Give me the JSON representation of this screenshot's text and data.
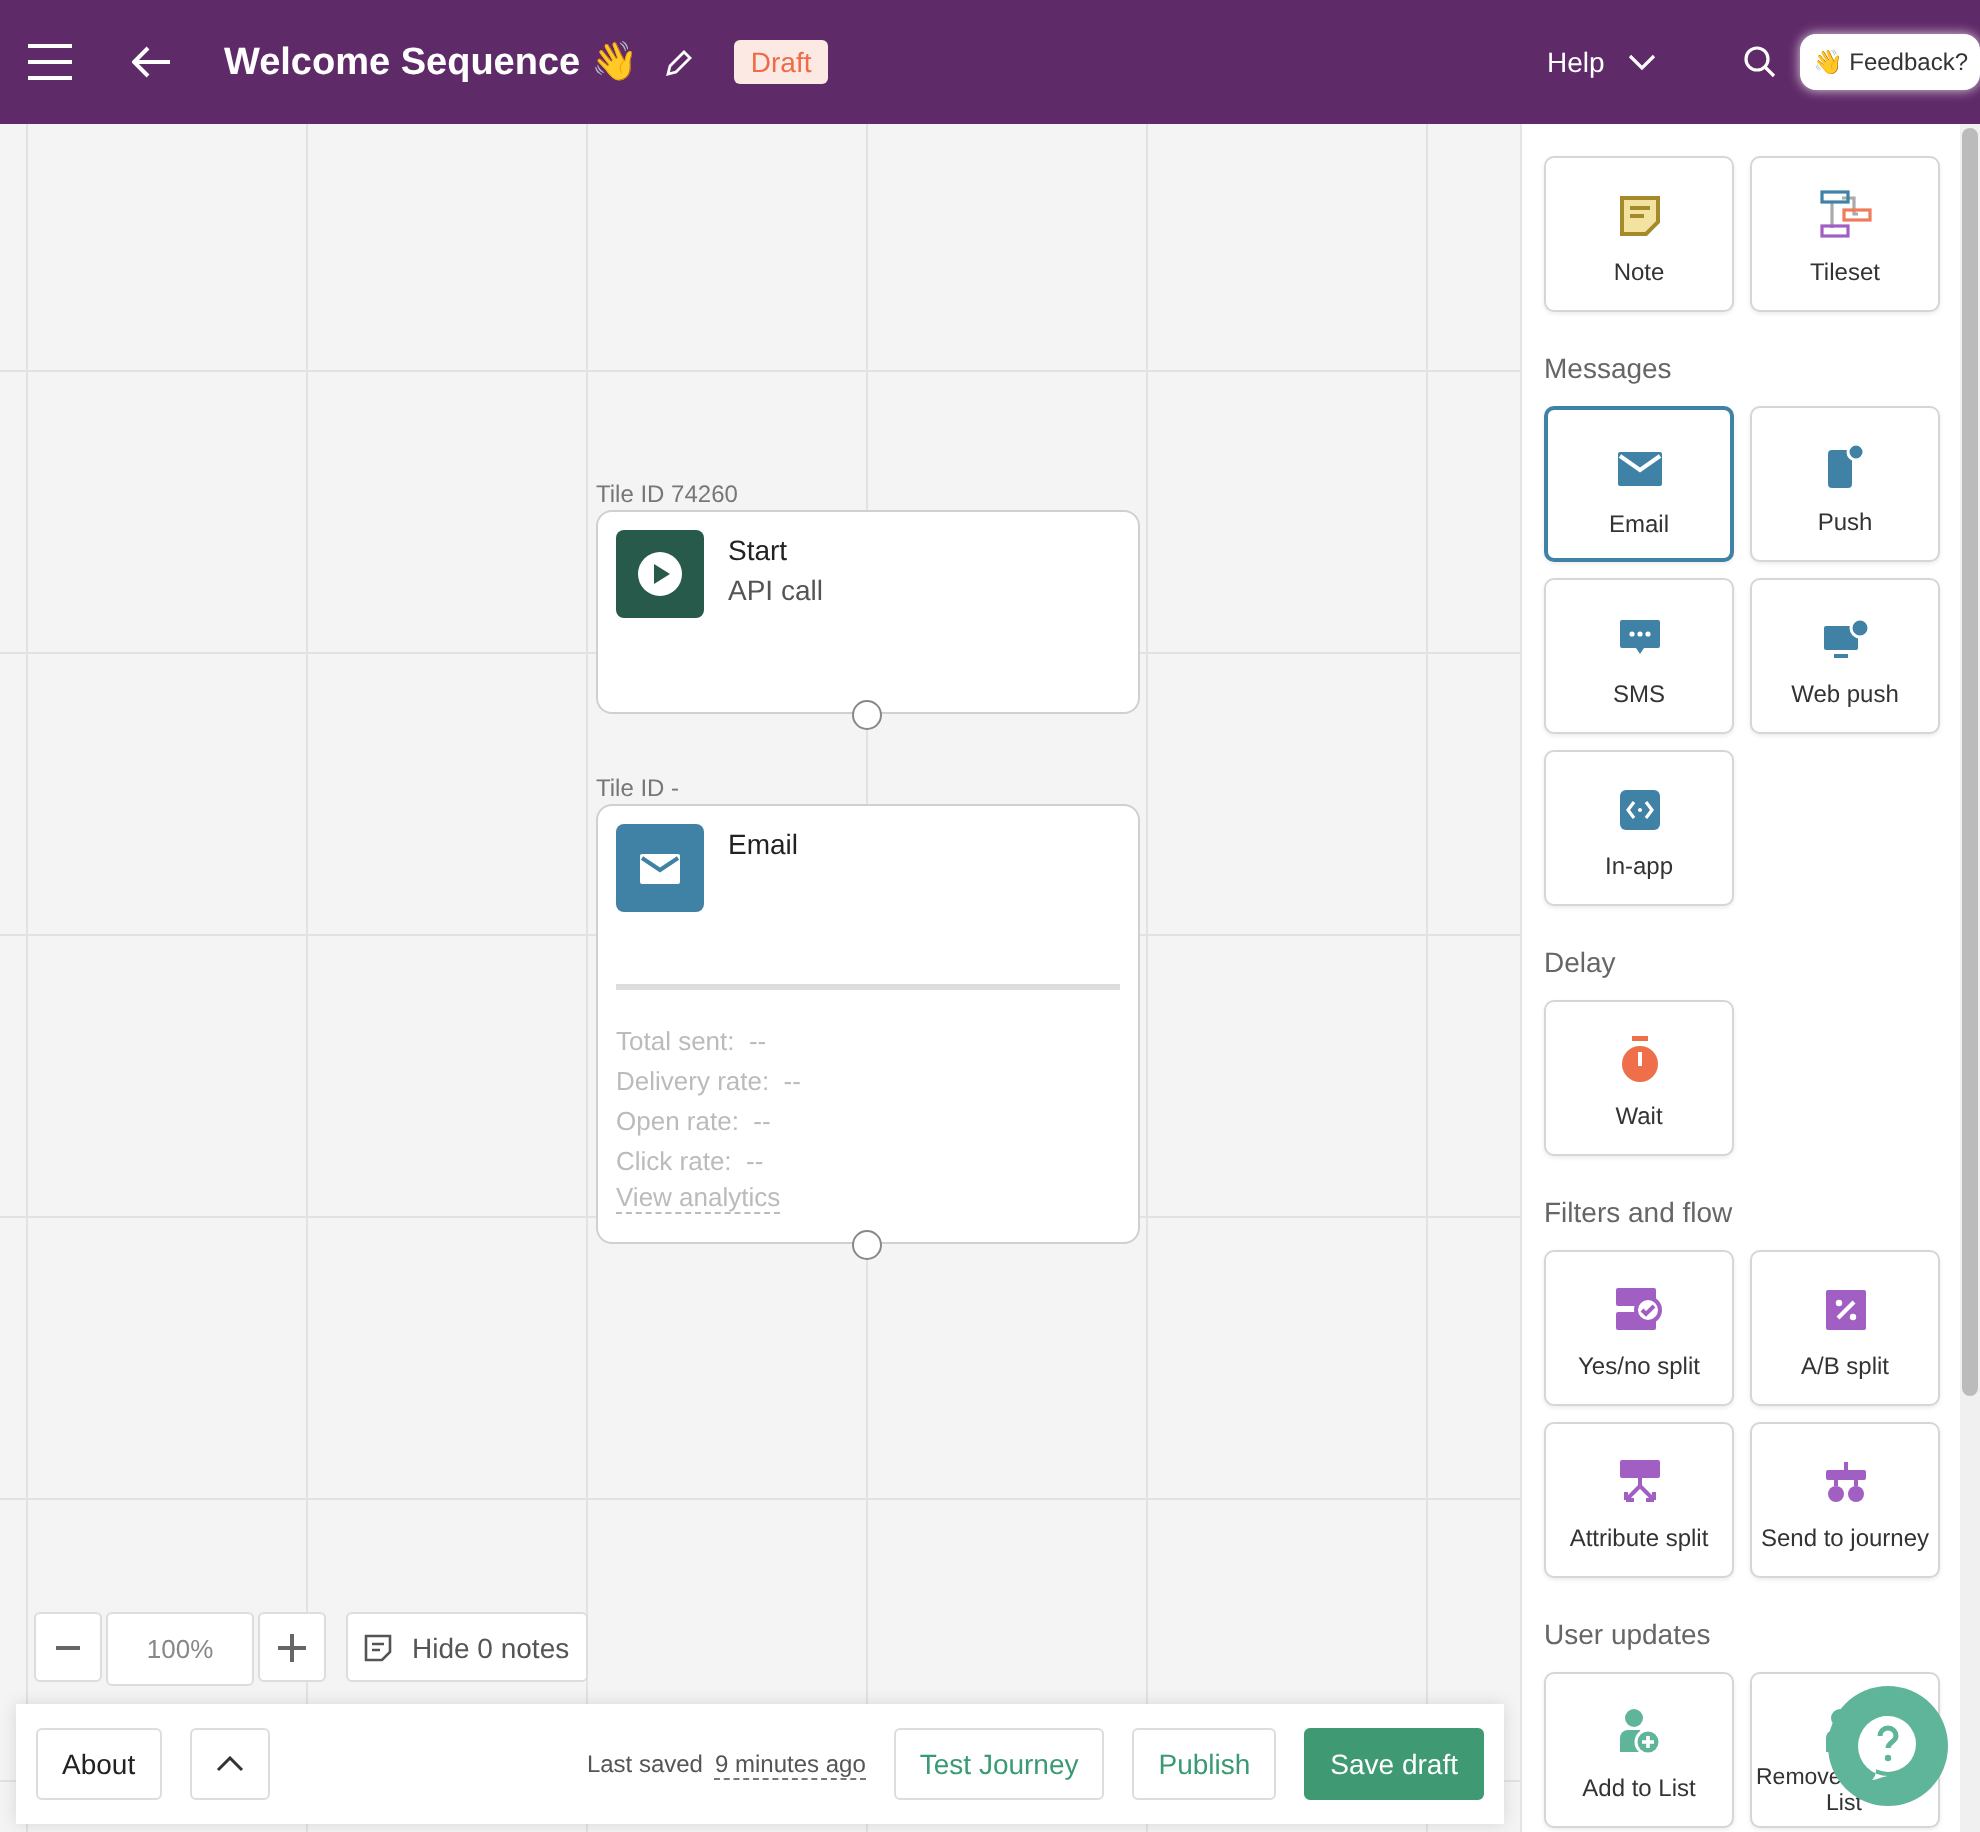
{
  "header": {
    "title": "Welcome Sequence 👋",
    "status": "Draft",
    "help": "Help",
    "feedback": "👋 Feedback?"
  },
  "canvas": {
    "tiles": [
      {
        "kind": "start",
        "tile_id": "Tile ID 74260",
        "title": "Start",
        "subtitle": "API call"
      },
      {
        "kind": "email",
        "tile_id": "Tile ID -",
        "title": "Email",
        "stats": [
          "Total sent:  --",
          "Delivery rate:  --",
          "Open rate:  --",
          "Click rate:  --"
        ],
        "link": "View analytics"
      }
    ],
    "zoom": "100%",
    "notes_button": "Hide 0 notes"
  },
  "footer": {
    "about": "About",
    "last_saved_label": "Last saved",
    "last_saved_time": "9 minutes ago",
    "buttons": [
      {
        "label": "Test Journey",
        "kind": "secondary"
      },
      {
        "label": "Publish",
        "kind": "secondary"
      },
      {
        "label": "Save draft",
        "kind": "primary"
      }
    ]
  },
  "palette": {
    "sections": [
      {
        "tiles": [
          {
            "label": "Note",
            "kind": "note",
            "selected": false
          },
          {
            "label": "Tileset",
            "kind": "tileset",
            "selected": false
          }
        ]
      },
      {
        "title": "Messages",
        "tiles": [
          {
            "label": "Email",
            "kind": "email",
            "selected": true
          },
          {
            "label": "Push",
            "kind": "push",
            "selected": false
          },
          {
            "label": "SMS",
            "kind": "sms",
            "selected": false
          },
          {
            "label": "Web push",
            "kind": "webpush",
            "selected": false
          },
          {
            "label": "In-app",
            "kind": "inapp",
            "selected": false
          }
        ]
      },
      {
        "title": "Delay",
        "tiles": [
          {
            "label": "Wait",
            "kind": "wait",
            "selected": false
          }
        ]
      },
      {
        "title": "Filters and flow",
        "tiles": [
          {
            "label": "Yes/no split",
            "kind": "yesno",
            "selected": false
          },
          {
            "label": "A/B split",
            "kind": "ab",
            "selected": false
          },
          {
            "label": "Attribute split",
            "kind": "attr",
            "selected": false
          },
          {
            "label": "Send to journey",
            "kind": "journey",
            "selected": false
          }
        ]
      },
      {
        "title": "User updates",
        "tiles": [
          {
            "label": "Add to List",
            "kind": "addlist",
            "selected": false
          },
          {
            "label": "Remove",
            "label_2": "List",
            "kind": "removelist",
            "selected": false
          }
        ]
      }
    ]
  }
}
